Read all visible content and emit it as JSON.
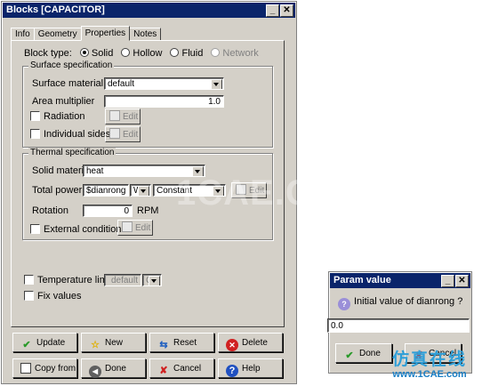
{
  "blocks_window": {
    "title": "Blocks [CAPACITOR]",
    "tabs": [
      "Info",
      "Geometry",
      "Properties",
      "Notes"
    ],
    "active_tab": "Properties",
    "block_type": {
      "label": "Block type:",
      "options": [
        "Solid",
        "Hollow",
        "Fluid",
        "Network"
      ],
      "selected": "Solid"
    },
    "surface": {
      "title": "Surface specification",
      "material_label": "Surface material",
      "material_value": "default",
      "area_label": "Area multiplier",
      "area_value": "1.0",
      "radiation_label": "Radiation",
      "individual_label": "Individual sides",
      "edit_label": "Edit"
    },
    "thermal": {
      "title": "Thermal specification",
      "solid_label": "Solid material",
      "solid_value": "heat",
      "power_label": "Total power",
      "power_value": "$dianrong",
      "power_unit": "W",
      "power_mode": "Constant",
      "edit_label": "Edit",
      "rotation_label": "Rotation",
      "rotation_value": "0",
      "rotation_unit": "RPM",
      "external_label": "External conditions"
    },
    "temp_limit_label": "Temperature limit",
    "temp_limit_value": "default",
    "temp_limit_unit": "C",
    "fix_values_label": "Fix values",
    "buttons": {
      "update": "Update",
      "new": "New",
      "reset": "Reset",
      "delete": "Delete",
      "copy_from": "Copy from",
      "done": "Done",
      "cancel": "Cancel",
      "help": "Help"
    }
  },
  "param_window": {
    "title": "Param value",
    "prompt": "Initial value of dianrong ?",
    "value": "0.0",
    "done": "Done",
    "cancel": "Cancel"
  },
  "watermark_text": "1CAE.COM",
  "brand": {
    "cn": "仿真在线",
    "url": "www.1CAE.com"
  },
  "colors": {
    "titlebar": "#0a246a",
    "face": "#d4d0c8",
    "brand_cn": "#2f9fd8",
    "brand_url": "#1a7ec4"
  }
}
